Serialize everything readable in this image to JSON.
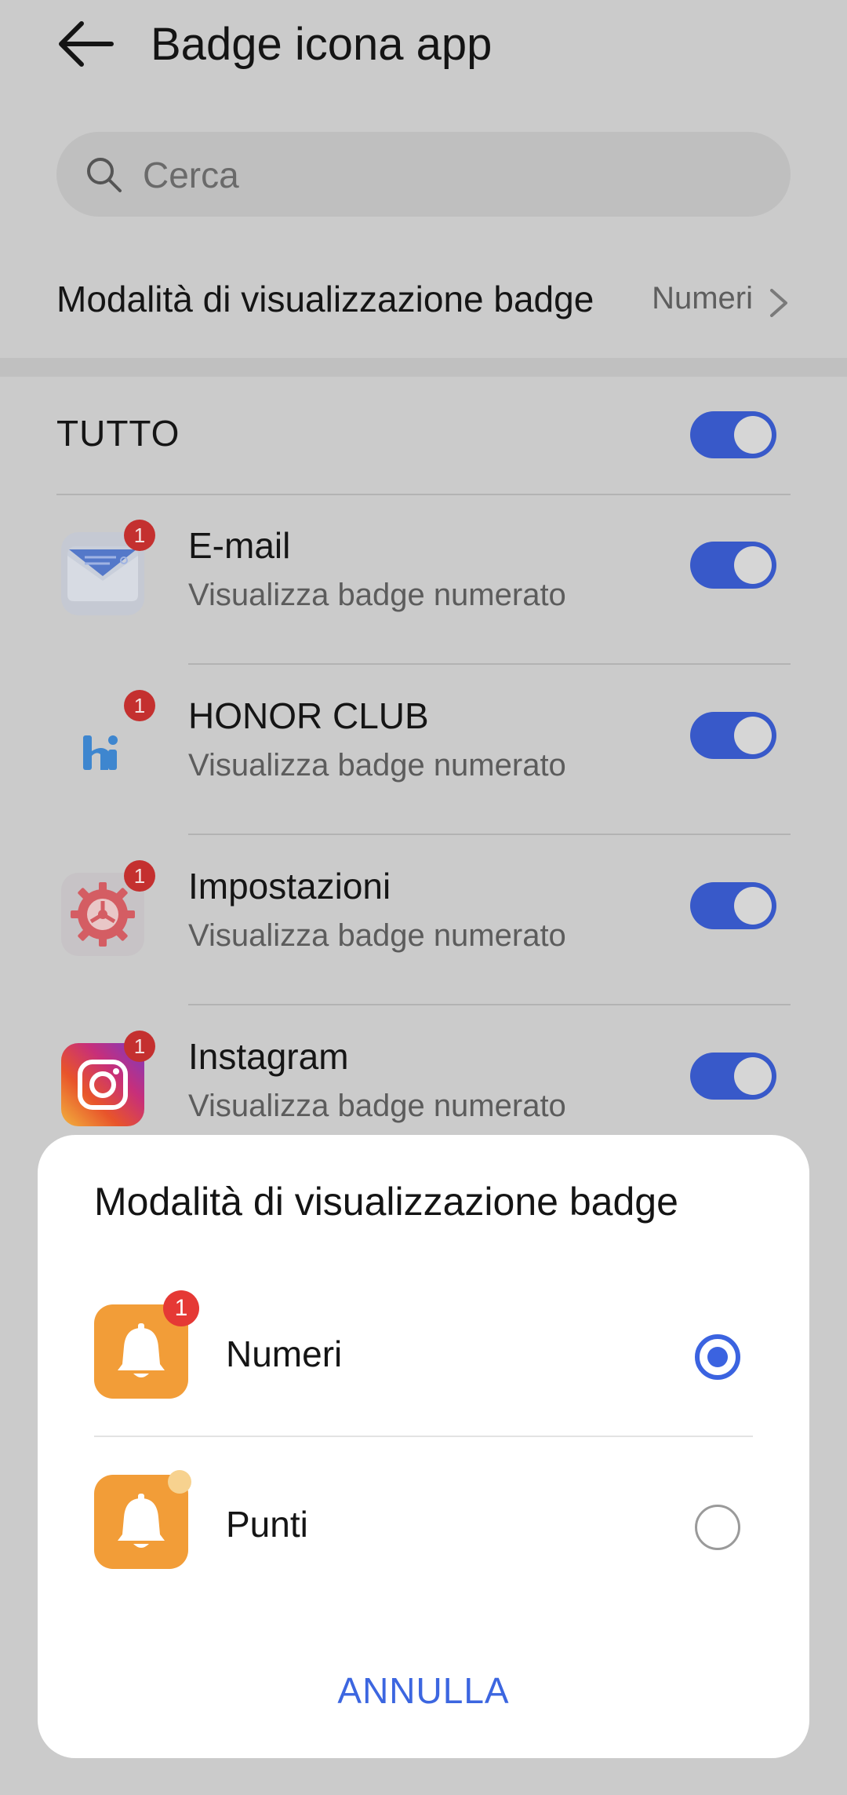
{
  "header": {
    "title": "Badge icona app",
    "back_icon": "arrow-left-icon"
  },
  "search": {
    "placeholder": "Cerca",
    "icon": "search-icon"
  },
  "badge_mode": {
    "label": "Modalità di visualizzazione badge",
    "value": "Numeri"
  },
  "all": {
    "label": "TUTTO",
    "enabled": true
  },
  "apps": [
    {
      "name": "E-mail",
      "subtitle": "Visualizza badge numerato",
      "badge": "1",
      "enabled": true,
      "icon": "email-envelope-icon"
    },
    {
      "name": "HONOR CLUB",
      "subtitle": "Visualizza badge numerato",
      "badge": "1",
      "enabled": true,
      "icon": "honor-club-icon"
    },
    {
      "name": "Impostazioni",
      "subtitle": "Visualizza badge numerato",
      "badge": "1",
      "enabled": true,
      "icon": "settings-gear-icon"
    },
    {
      "name": "Instagram",
      "subtitle": "Visualizza badge numerato",
      "badge": "1",
      "enabled": true,
      "icon": "instagram-icon"
    }
  ],
  "sheet": {
    "title": "Modalità di visualizzazione badge",
    "options": [
      {
        "label": "Numeri",
        "badge": "1",
        "selected": true,
        "icon": "bell-icon"
      },
      {
        "label": "Punti",
        "selected": false,
        "icon": "bell-icon"
      }
    ],
    "cancel_label": "ANNULLA"
  },
  "colors": {
    "accent": "#3b63e0",
    "toggle_on": "#3859c9",
    "badge_red": "#e53935",
    "bell_orange": "#f29d38"
  }
}
